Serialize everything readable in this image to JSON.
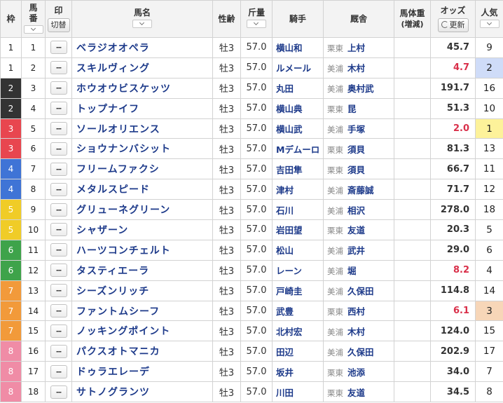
{
  "header": {
    "waku": "枠",
    "umaban_top": "馬",
    "umaban_bottom": "番",
    "mark": "印",
    "mark_toggle": "切替",
    "horse_name": "馬名",
    "sex_age": "性齢",
    "weight": "斤量",
    "jockey": "騎手",
    "trainer": "厩舎",
    "body_weight_top": "馬体重",
    "body_weight_bottom": "(増減)",
    "odds": "オッズ",
    "refresh": "更新",
    "ninki_top": "人気"
  },
  "colors": {
    "waku": {
      "1": {
        "bg": "#ffffff",
        "fg": "#222222"
      },
      "2": {
        "bg": "#333333",
        "fg": "#ffffff"
      },
      "3": {
        "bg": "#e8464f",
        "fg": "#ffffff"
      },
      "4": {
        "bg": "#3f74d6",
        "fg": "#ffffff"
      },
      "5": {
        "bg": "#f0cc27",
        "fg": "#ffffff"
      },
      "6": {
        "bg": "#3ea34a",
        "fg": "#ffffff"
      },
      "7": {
        "bg": "#f29a3a",
        "fg": "#ffffff"
      },
      "8": {
        "bg": "#f08ca6",
        "fg": "#ffffff"
      }
    }
  },
  "rows": [
    {
      "waku": "1",
      "umaban": "1",
      "mark": "--",
      "name": "ベラジオオペラ",
      "sex_age": "牡3",
      "weight": "57.0",
      "jockey": "横山和",
      "region": "栗東",
      "trainer": "上村",
      "body_weight": "",
      "odds": "45.7",
      "hot": false,
      "ninki": "9"
    },
    {
      "waku": "1",
      "umaban": "2",
      "mark": "--",
      "name": "スキルヴィング",
      "sex_age": "牡3",
      "weight": "57.0",
      "jockey": "ルメール",
      "region": "美浦",
      "trainer": "木村",
      "body_weight": "",
      "odds": "4.7",
      "hot": true,
      "ninki": "2"
    },
    {
      "waku": "2",
      "umaban": "3",
      "mark": "--",
      "name": "ホウオウビスケッツ",
      "sex_age": "牡3",
      "weight": "57.0",
      "jockey": "丸田",
      "region": "美浦",
      "trainer": "奥村武",
      "body_weight": "",
      "odds": "191.7",
      "hot": false,
      "ninki": "16"
    },
    {
      "waku": "2",
      "umaban": "4",
      "mark": "--",
      "name": "トップナイフ",
      "sex_age": "牡3",
      "weight": "57.0",
      "jockey": "横山典",
      "region": "栗東",
      "trainer": "昆",
      "body_weight": "",
      "odds": "51.3",
      "hot": false,
      "ninki": "10"
    },
    {
      "waku": "3",
      "umaban": "5",
      "mark": "--",
      "name": "ソールオリエンス",
      "sex_age": "牡3",
      "weight": "57.0",
      "jockey": "横山武",
      "region": "美浦",
      "trainer": "手塚",
      "body_weight": "",
      "odds": "2.0",
      "hot": true,
      "ninki": "1"
    },
    {
      "waku": "3",
      "umaban": "6",
      "mark": "--",
      "name": "ショウナンバシット",
      "sex_age": "牡3",
      "weight": "57.0",
      "jockey": "Mデムーロ",
      "region": "栗東",
      "trainer": "須貝",
      "body_weight": "",
      "odds": "81.3",
      "hot": false,
      "ninki": "13"
    },
    {
      "waku": "4",
      "umaban": "7",
      "mark": "--",
      "name": "フリームファクシ",
      "sex_age": "牡3",
      "weight": "57.0",
      "jockey": "吉田隼",
      "region": "栗東",
      "trainer": "須貝",
      "body_weight": "",
      "odds": "66.7",
      "hot": false,
      "ninki": "11"
    },
    {
      "waku": "4",
      "umaban": "8",
      "mark": "--",
      "name": "メタルスピード",
      "sex_age": "牡3",
      "weight": "57.0",
      "jockey": "津村",
      "region": "美浦",
      "trainer": "斎藤誠",
      "body_weight": "",
      "odds": "71.7",
      "hot": false,
      "ninki": "12"
    },
    {
      "waku": "5",
      "umaban": "9",
      "mark": "--",
      "name": "グリューネグリーン",
      "sex_age": "牡3",
      "weight": "57.0",
      "jockey": "石川",
      "region": "美浦",
      "trainer": "相沢",
      "body_weight": "",
      "odds": "278.0",
      "hot": false,
      "ninki": "18"
    },
    {
      "waku": "5",
      "umaban": "10",
      "mark": "--",
      "name": "シャザーン",
      "sex_age": "牡3",
      "weight": "57.0",
      "jockey": "岩田望",
      "region": "栗東",
      "trainer": "友道",
      "body_weight": "",
      "odds": "20.3",
      "hot": false,
      "ninki": "5"
    },
    {
      "waku": "6",
      "umaban": "11",
      "mark": "--",
      "name": "ハーツコンチェルト",
      "sex_age": "牡3",
      "weight": "57.0",
      "jockey": "松山",
      "region": "美浦",
      "trainer": "武井",
      "body_weight": "",
      "odds": "29.0",
      "hot": false,
      "ninki": "6"
    },
    {
      "waku": "6",
      "umaban": "12",
      "mark": "--",
      "name": "タスティエーラ",
      "sex_age": "牡3",
      "weight": "57.0",
      "jockey": "レーン",
      "region": "美浦",
      "trainer": "堀",
      "body_weight": "",
      "odds": "8.2",
      "hot": true,
      "ninki": "4"
    },
    {
      "waku": "7",
      "umaban": "13",
      "mark": "--",
      "name": "シーズンリッチ",
      "sex_age": "牡3",
      "weight": "57.0",
      "jockey": "戸崎圭",
      "region": "美浦",
      "trainer": "久保田",
      "body_weight": "",
      "odds": "114.8",
      "hot": false,
      "ninki": "14"
    },
    {
      "waku": "7",
      "umaban": "14",
      "mark": "--",
      "name": "ファントムシーフ",
      "sex_age": "牡3",
      "weight": "57.0",
      "jockey": "武豊",
      "region": "栗東",
      "trainer": "西村",
      "body_weight": "",
      "odds": "6.1",
      "hot": true,
      "ninki": "3"
    },
    {
      "waku": "7",
      "umaban": "15",
      "mark": "--",
      "name": "ノッキングポイント",
      "sex_age": "牡3",
      "weight": "57.0",
      "jockey": "北村宏",
      "region": "美浦",
      "trainer": "木村",
      "body_weight": "",
      "odds": "124.0",
      "hot": false,
      "ninki": "15"
    },
    {
      "waku": "8",
      "umaban": "16",
      "mark": "--",
      "name": "パクスオトマニカ",
      "sex_age": "牡3",
      "weight": "57.0",
      "jockey": "田辺",
      "region": "美浦",
      "trainer": "久保田",
      "body_weight": "",
      "odds": "202.9",
      "hot": false,
      "ninki": "17"
    },
    {
      "waku": "8",
      "umaban": "17",
      "mark": "--",
      "name": "ドゥラエレーデ",
      "sex_age": "牡3",
      "weight": "57.0",
      "jockey": "坂井",
      "region": "栗東",
      "trainer": "池添",
      "body_weight": "",
      "odds": "34.0",
      "hot": false,
      "ninki": "7"
    },
    {
      "waku": "8",
      "umaban": "18",
      "mark": "--",
      "name": "サトノグランツ",
      "sex_age": "牡3",
      "weight": "57.0",
      "jockey": "川田",
      "region": "栗東",
      "trainer": "友道",
      "body_weight": "",
      "odds": "34.5",
      "hot": false,
      "ninki": "8"
    }
  ]
}
